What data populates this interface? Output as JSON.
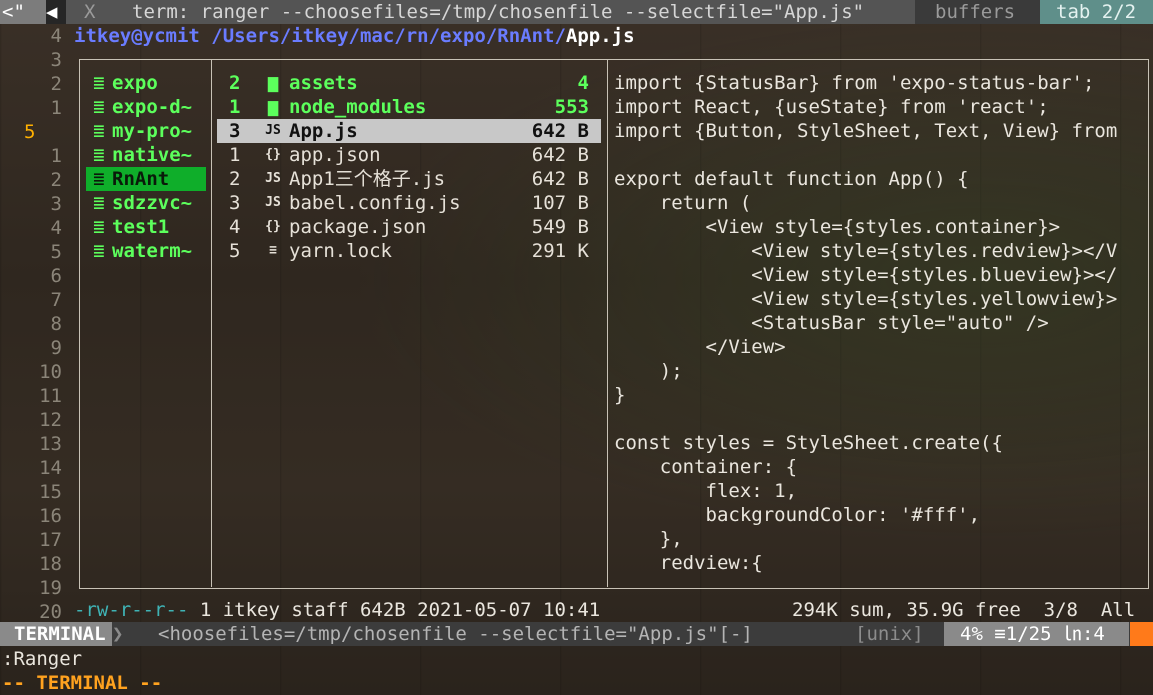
{
  "tabline": {
    "left": "<\"",
    "arrow": "◀",
    "close": "X",
    "active_tab": "term: ranger --choosefiles=/tmp/chosenfile --selectfile=\"App.js\"",
    "buffers": "buffers",
    "tab_count": "tab 2/2"
  },
  "gutter": [
    "4",
    "3",
    "2",
    "1",
    "5",
    "1",
    "2",
    "3",
    "4",
    "5",
    "6",
    "7",
    "8",
    "9",
    "10",
    "11",
    "12",
    "13",
    "14",
    "15",
    "16",
    "17",
    "18",
    "19",
    "20"
  ],
  "path": {
    "host": "itkey@ycmit",
    "dir": " /Users/itkey/mac/rn/expo/RnAnt/",
    "file": "App.js"
  },
  "parent_dirs": [
    {
      "label": "expo"
    },
    {
      "label": "expo-d~"
    },
    {
      "label": "my-pro~"
    },
    {
      "label": "native~"
    },
    {
      "label": "RnAnt",
      "selected": true
    },
    {
      "label": "sdzzvc~"
    },
    {
      "label": "test1"
    },
    {
      "label": "waterm~"
    }
  ],
  "files": [
    {
      "n": "2",
      "icon": "folder-icon",
      "glyph": "▆",
      "name": "assets",
      "size": "4",
      "dir": true
    },
    {
      "n": "1",
      "icon": "folder-icon",
      "glyph": "▆",
      "name": "node_modules",
      "size": "553",
      "dir": true
    },
    {
      "n": "3",
      "icon": "js-icon",
      "glyph": "JS",
      "name": "App.js",
      "size": "642 B",
      "selected": true
    },
    {
      "n": "1",
      "icon": "json-icon",
      "glyph": "{}",
      "name": "app.json",
      "size": "642 B"
    },
    {
      "n": "2",
      "icon": "js-icon",
      "glyph": "JS",
      "name": "App1三个格子.js",
      "size": "642 B"
    },
    {
      "n": "3",
      "icon": "js-icon",
      "glyph": "JS",
      "name": "babel.config.js",
      "size": "107 B"
    },
    {
      "n": "4",
      "icon": "json-icon",
      "glyph": "{}",
      "name": "package.json",
      "size": "549 B"
    },
    {
      "n": "5",
      "icon": "text-file-icon",
      "glyph": "≡",
      "name": "yarn.lock",
      "size": "291 K"
    }
  ],
  "preview": [
    "import {StatusBar} from 'expo-status-bar';",
    "import React, {useState} from 'react';",
    "import {Button, StyleSheet, Text, View} from",
    "",
    "export default function App() {",
    "    return (",
    "        <View style={styles.container}>",
    "            <View style={styles.redview}></V",
    "            <View style={styles.blueview}></",
    "            <View style={styles.yellowview}>",
    "            <StatusBar style=\"auto\" />",
    "        </View>",
    "    );",
    "}",
    "",
    "const styles = StyleSheet.create({",
    "    container: {",
    "        flex: 1,",
    "        backgroundColor: '#fff',",
    "    },",
    "    redview:{"
  ],
  "ranger_status": {
    "perm": "-rw-r--r--",
    "info": " 1 itkey staff 642B 2021-05-07 10:41",
    "right": "294K sum, 35.9G free  3/8  All"
  },
  "statusline": {
    "mode": "TERMINAL",
    "arrow": "❯",
    "file": "<hoosefiles=/tmp/chosenfile --selectfile=\"App.js\"[-]",
    "fileformat": "[unix]",
    "position": "4% ≡1/25 ㏑:4"
  },
  "cmdline": ":Ranger",
  "modeline": "-- TERMINAL --"
}
